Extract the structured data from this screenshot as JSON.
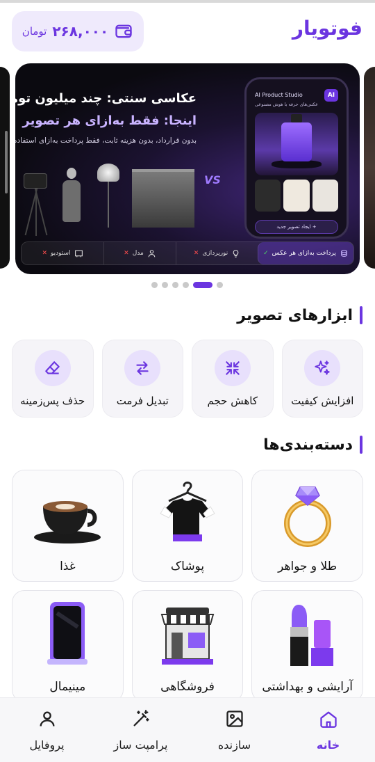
{
  "app": {
    "title": "فوتویار"
  },
  "wallet": {
    "amount": "۲۶۸,۰۰۰",
    "currency": "تومان"
  },
  "banner": {
    "headline_1": "عکاسی سنتی: چند میلیون تومان",
    "headline_2": "اینجا: فقط به‌ازای هر تصویر",
    "subtitle": "بدون قرارداد، بدون هزینه ثابت، فقط پرداخت به‌ازای استفاده",
    "vs_label": "VS",
    "phone": {
      "app_name": "AI Product Studio",
      "app_desc": "عکس‌های حرفه با هوش مصنوعی",
      "ai_badge": "AI",
      "button": "ایجاد تصویر جدید +"
    },
    "comparison": [
      {
        "label": "پرداخت به‌ازای هر عکس",
        "mark": "✓",
        "highlight": true
      },
      {
        "label": "نورپردازی",
        "mark": "✕"
      },
      {
        "label": "مدل",
        "mark": "✕"
      },
      {
        "label": "استودیو",
        "mark": "✕"
      }
    ]
  },
  "carousel": {
    "count": 6,
    "active_index": 4
  },
  "tools_section": {
    "title": "ابزارهای تصویر",
    "items": [
      {
        "label": "افزایش کیفیت",
        "icon": "sparkles-icon"
      },
      {
        "label": "کاهش حجم",
        "icon": "compress-arrows-icon"
      },
      {
        "label": "تبدیل فرمت",
        "icon": "swap-arrows-icon"
      },
      {
        "label": "حذف پس‌زمینه",
        "icon": "eraser-icon"
      }
    ]
  },
  "categories_section": {
    "title": "دسته‌بندی‌ها",
    "items": [
      {
        "label": "طلا و جواهر",
        "icon": "diamond-ring-image"
      },
      {
        "label": "پوشاک",
        "icon": "tshirt-hanger-image"
      },
      {
        "label": "غذا",
        "icon": "coffee-cup-image"
      },
      {
        "label": "آرایشی و بهداشتی",
        "icon": "lipstick-image"
      },
      {
        "label": "فروشگاهی",
        "icon": "storefront-image"
      },
      {
        "label": "مینیمال",
        "icon": "phone-minimal-image"
      }
    ]
  },
  "colors": {
    "accent": "#6b35e0",
    "accent_light": "#e8e0fc",
    "background": "#ffffff"
  },
  "nav": {
    "items": [
      {
        "label": "خانه",
        "icon": "home-icon",
        "active": true
      },
      {
        "label": "سازنده",
        "icon": "image-icon"
      },
      {
        "label": "پرامپت ساز",
        "icon": "magic-wand-icon"
      },
      {
        "label": "پروفایل",
        "icon": "user-icon"
      }
    ]
  }
}
